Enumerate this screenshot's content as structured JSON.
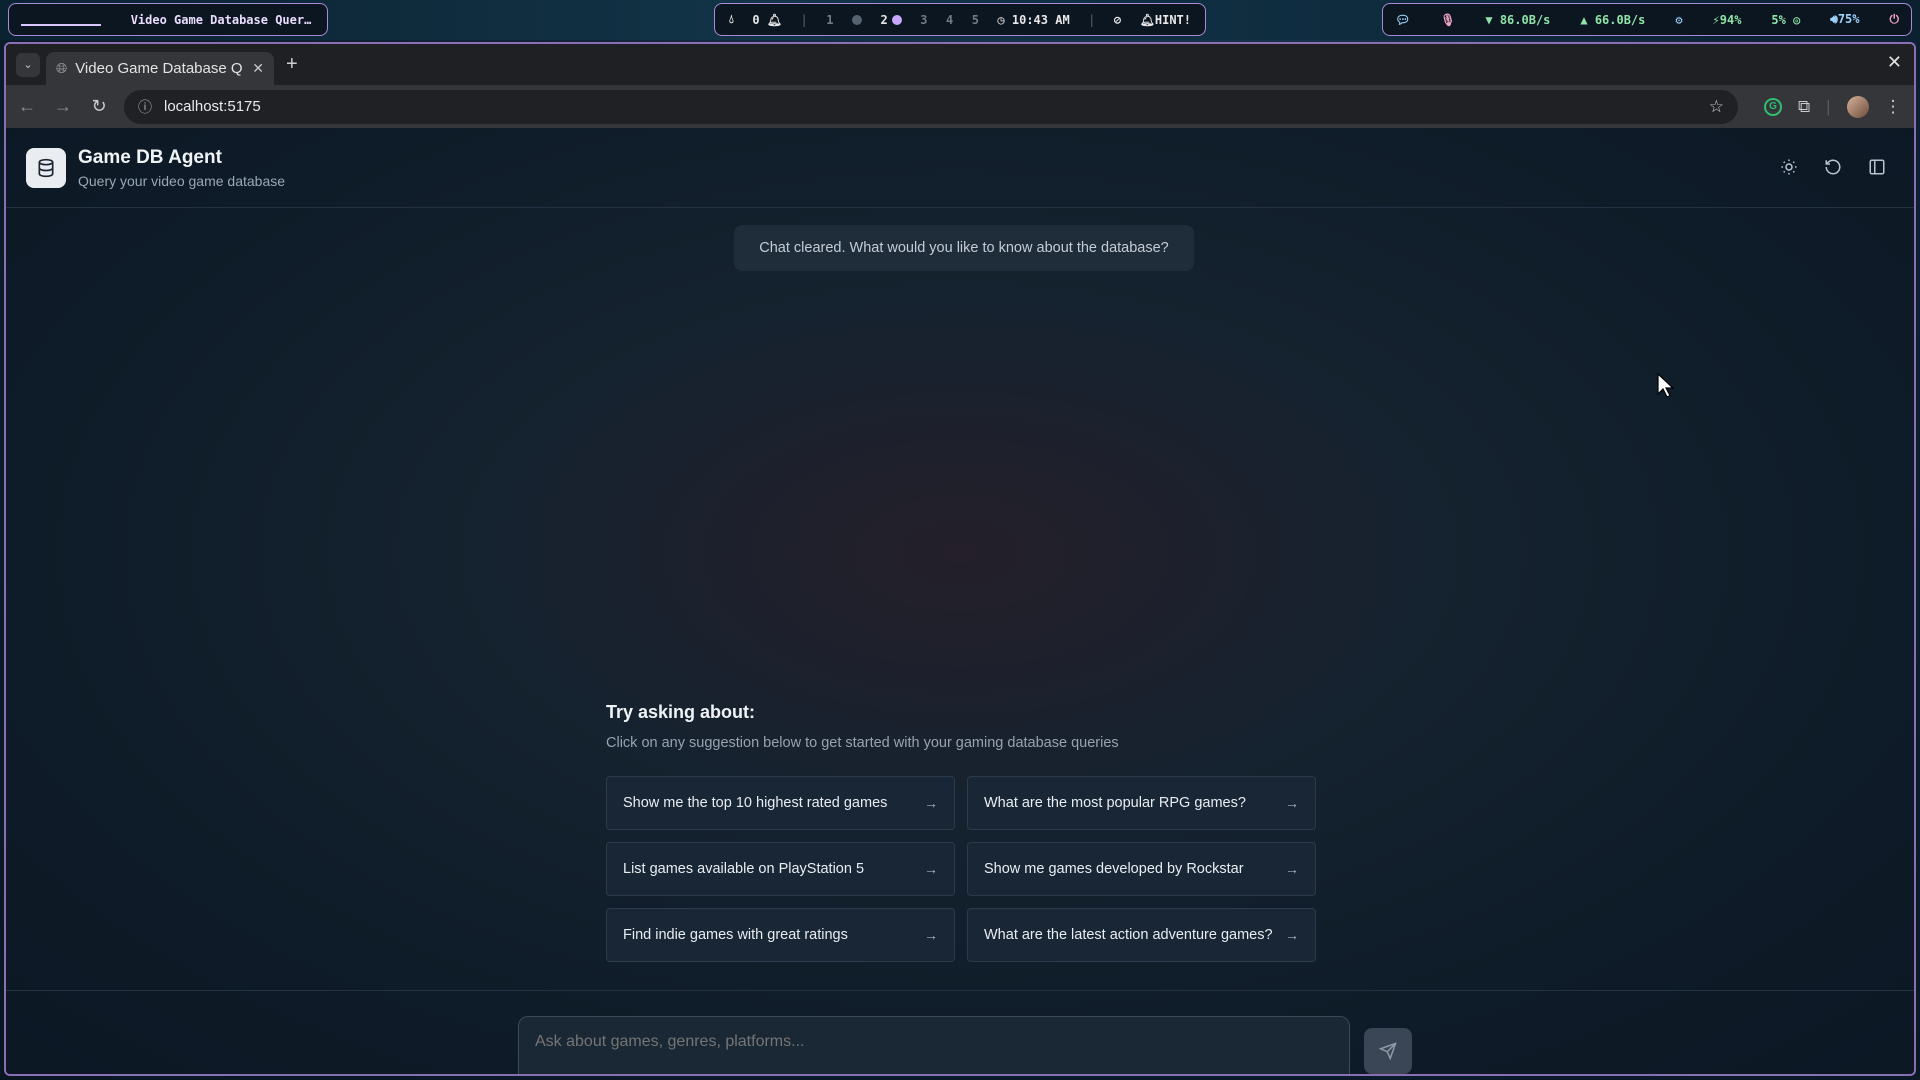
{
  "system_bar": {
    "window_title": "Video Game Database Query…",
    "left_indicator": "⬯",
    "notifications": "0",
    "workspaces": [
      "1",
      "2",
      "3",
      "4",
      "5"
    ],
    "time": "10:43 AM",
    "hint": "HINT!",
    "net_down": "86.0B/s",
    "net_up": "66.0B/s",
    "battery": "94%",
    "cpu": "5%",
    "volume": "75%"
  },
  "browser": {
    "tab_title": "Video Game Database Q",
    "url": "localhost:5175"
  },
  "app": {
    "title": "Game DB Agent",
    "subtitle": "Query your video game database",
    "system_message": "Chat cleared. What would you like to know about the database?",
    "suggestions_title": "Try asking about:",
    "suggestions_subtitle": "Click on any suggestion below to get started with your gaming database queries",
    "suggestions": [
      "Show me the top 10 highest rated games",
      "What are the most popular RPG games?",
      "List games available on PlayStation 5",
      "Show me games developed by Rockstar",
      "Find indie games with great ratings",
      "What are the latest action adventure games?"
    ],
    "input_placeholder": "Ask about games, genres, platforms..."
  },
  "colors": {
    "accent_border": "#a88bd6",
    "app_bg": "#0e1b28",
    "card_bg": "#182636"
  }
}
